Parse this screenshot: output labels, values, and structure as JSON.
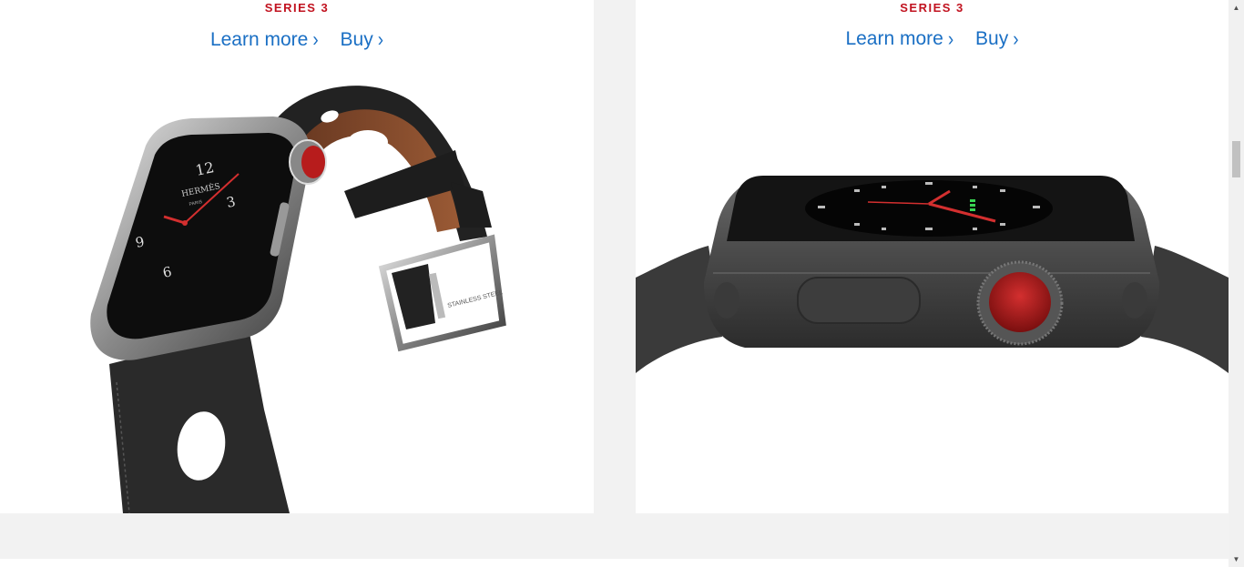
{
  "tiles": [
    {
      "eyebrow": "SERIES 3",
      "learn_more": "Learn more",
      "buy": "Buy",
      "chevron": "›"
    },
    {
      "eyebrow": "SERIES 3",
      "learn_more": "Learn more",
      "buy": "Buy",
      "chevron": "›"
    }
  ],
  "watch_face_left": {
    "brand": "HERMÈS",
    "city": "PARIS",
    "numerals": [
      "12",
      "3",
      "6",
      "9"
    ]
  },
  "buckle_engraving": "STAINLESS STEEL",
  "scrollbar": {
    "up_arrow": "▲",
    "down_arrow": "▼"
  },
  "colors": {
    "accent_link": "#1a6fc4",
    "eyebrow_red": "#c1121f",
    "page_bg": "#f2f2f2"
  }
}
